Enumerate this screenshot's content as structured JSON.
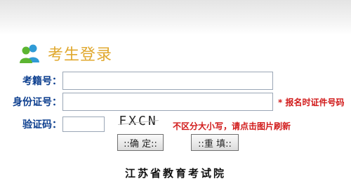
{
  "header": {
    "title": "考生登录",
    "icon": "users-icon"
  },
  "form": {
    "candidate_id": {
      "label": "考籍号：",
      "value": ""
    },
    "id_number": {
      "label": "身份证号：",
      "value": "",
      "hint": "* 报名时证件号码"
    },
    "verify_code": {
      "label": "验证码：",
      "value": "",
      "captcha_text": "FXCN",
      "hint": "不区分大小写，请点击图片刷新"
    }
  },
  "buttons": {
    "confirm_label": "::确 定::",
    "reset_label": "::重 填::"
  },
  "footer": {
    "org": "江苏省教育考试院"
  },
  "colors": {
    "label": "#0d3f8f",
    "title": "#e0a82e",
    "hint": "#d11a1a"
  }
}
